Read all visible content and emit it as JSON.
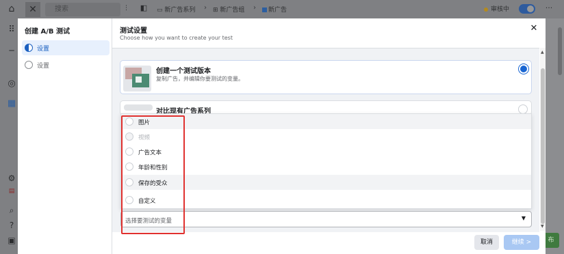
{
  "topbar": {
    "search_placeholder": "搜索",
    "breadcrumbs": [
      "新广告系列",
      "新广告组",
      "新广告"
    ],
    "status": "审核中",
    "more": "···"
  },
  "dialog": {
    "sidebar_title": "创建 A/B 测试",
    "steps": [
      {
        "label": "设置",
        "active": true
      },
      {
        "label": "设置",
        "active": false
      }
    ],
    "title": "测试设置",
    "subtitle": "Choose how you want to create your test",
    "option_new": {
      "title": "创建一个测试版本",
      "description": "复制广告，并编辑你要测试的变量。"
    },
    "option_compare": {
      "title": "对比现有广告系列"
    },
    "variable_options": [
      {
        "label": "图片",
        "highlighted": true,
        "disabled": false
      },
      {
        "label": "视频",
        "highlighted": false,
        "disabled": true
      },
      {
        "label": "广告文本",
        "highlighted": false,
        "disabled": false
      },
      {
        "label": "年龄和性别",
        "highlighted": false,
        "disabled": false
      },
      {
        "label": "保存的受众",
        "highlighted": true,
        "disabled": false
      },
      {
        "label": "自定义",
        "highlighted": false,
        "disabled": false
      }
    ],
    "select_placeholder": "选择要测试的变量",
    "cancel_label": "取消",
    "next_label": "继续 >"
  },
  "background": {
    "green_button_label": "布"
  },
  "colors": {
    "accent": "#1a66d2",
    "highlight_box": "#e0302e"
  }
}
